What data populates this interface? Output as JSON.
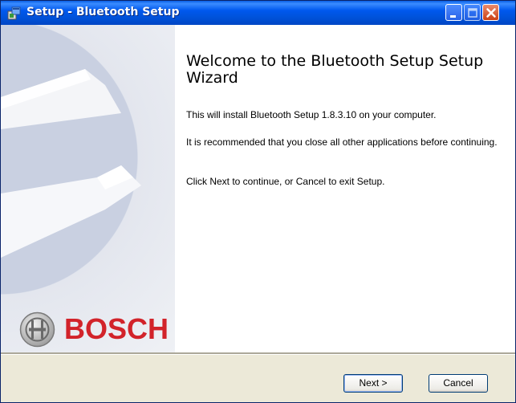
{
  "window": {
    "title": "Setup - Bluetooth Setup"
  },
  "sidebar": {
    "brand": "BOSCH"
  },
  "main": {
    "heading": "Welcome to the Bluetooth Setup Setup Wizard",
    "paragraphs": [
      "This will install Bluetooth Setup 1.8.3.10 on your computer.",
      "It is recommended that you close all other applications before continuing.",
      "Click Next to continue, or Cancel to exit Setup."
    ]
  },
  "buttons": {
    "next": "Next >",
    "cancel": "Cancel"
  },
  "colors": {
    "titlebar": "#0054e3",
    "brand_red": "#d2232a",
    "dialog_bg": "#ece9d8"
  },
  "icons": [
    "setup-app-icon",
    "minimize-icon",
    "maximize-icon",
    "close-icon",
    "bosch-logo-icon"
  ]
}
